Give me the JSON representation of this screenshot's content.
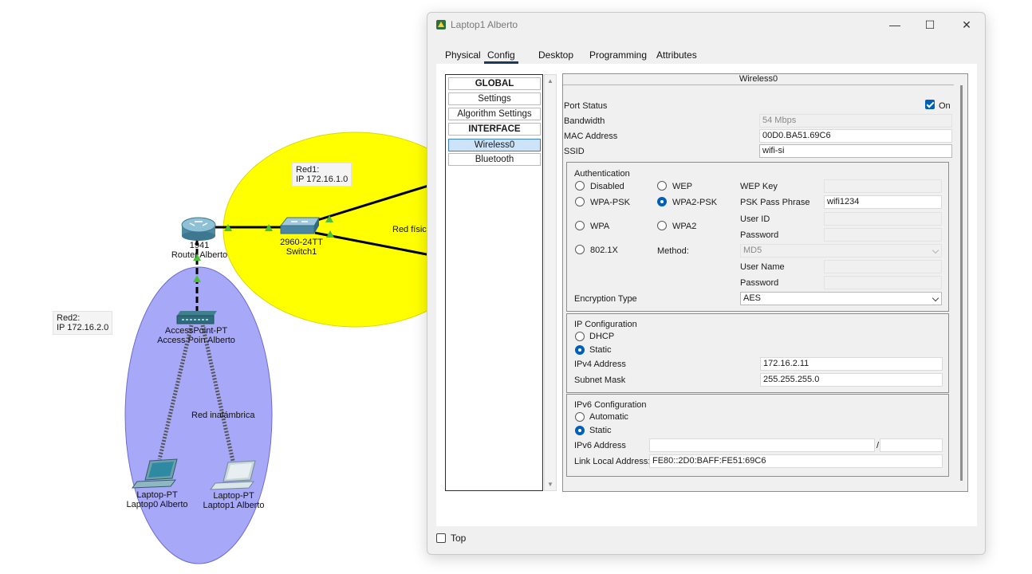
{
  "topology": {
    "notes": {
      "red1_line1": "Red1:",
      "red1_line2": "IP 172.16.1.0",
      "red2_line1": "Red2:",
      "red2_line2": "IP 172.16.2.0"
    },
    "router": {
      "model": "1941",
      "name": "Router Alberto"
    },
    "switch": {
      "model": "2960-24TT",
      "name": "Switch1"
    },
    "access_point": {
      "model": "AccessPoint-PT",
      "name": "Access Poin Alberto"
    },
    "laptop0": {
      "model": "Laptop-PT",
      "name": "Laptop0 Alberto"
    },
    "laptop1": {
      "model": "Laptop-PT",
      "name": "Laptop1 Alberto"
    },
    "red_fisica_label": "Red físic",
    "red_inalambrica_label": "Red inalámbrica",
    "colors": {
      "red1_area": "#ffff00",
      "red2_area": "#a8a8f8",
      "link_up": "#4bbf3a"
    }
  },
  "window": {
    "title": "Laptop1 Alberto",
    "controls": {
      "minimize": "—",
      "maximize": "☐",
      "close": "✕"
    },
    "tabs": [
      "Physical",
      "Config",
      "Desktop",
      "Programming",
      "Attributes"
    ],
    "active_tab": "Config",
    "sidebar": {
      "items": [
        {
          "label": "GLOBAL",
          "header": true
        },
        {
          "label": "Settings"
        },
        {
          "label": "Algorithm Settings"
        },
        {
          "label": "INTERFACE",
          "header": true
        },
        {
          "label": "Wireless0",
          "selected": true
        },
        {
          "label": "Bluetooth"
        }
      ]
    },
    "panel": {
      "title": "Wireless0",
      "port_status_label": "Port Status",
      "on_label": "On",
      "port_on": true,
      "bandwidth_label": "Bandwidth",
      "bandwidth_value": "54 Mbps",
      "mac_label": "MAC Address",
      "mac_value": "00D0.BA51.69C6",
      "ssid_label": "SSID",
      "ssid_value": "wifi-si",
      "auth": {
        "title": "Authentication",
        "disabled": "Disabled",
        "wep": "WEP",
        "wpa_psk": "WPA-PSK",
        "wpa2_psk": "WPA2-PSK",
        "wpa": "WPA",
        "wpa2": "WPA2",
        "x8021": "802.1X",
        "selected": "WPA2-PSK",
        "method_label": "Method:",
        "method_value": "MD5",
        "wep_key_label": "WEP Key",
        "psk_label": "PSK Pass Phrase",
        "psk_value": "wifi1234",
        "user_id_label": "User ID",
        "password_label": "Password",
        "user_name_label": "User Name",
        "password2_label": "Password",
        "encryption_label": "Encryption Type",
        "encryption_value": "AES"
      },
      "ip": {
        "title": "IP Configuration",
        "dhcp": "DHCP",
        "static": "Static",
        "ipv4_label": "IPv4 Address",
        "ipv4_value": "172.16.2.11",
        "mask_label": "Subnet Mask",
        "mask_value": "255.255.255.0"
      },
      "ipv6": {
        "title": "IPv6 Configuration",
        "automatic": "Automatic",
        "static": "Static",
        "addr_label": "IPv6 Address",
        "slash": "/",
        "link_local_label": "Link Local Address:",
        "link_local_value": "FE80::2D0:BAFF:FE51:69C6"
      }
    },
    "top_label": "Top"
  }
}
